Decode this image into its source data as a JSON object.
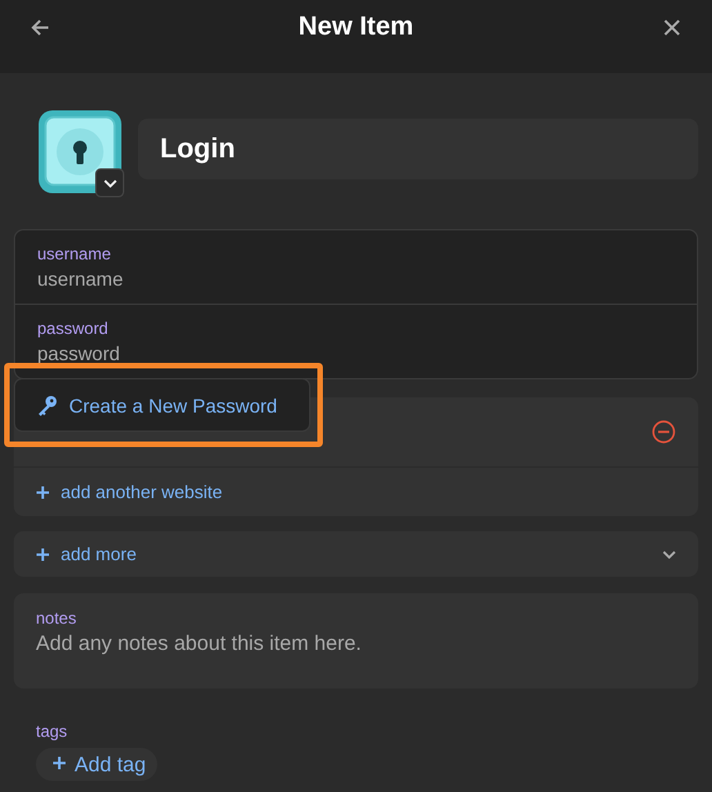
{
  "header": {
    "title": "New Item"
  },
  "item": {
    "name": "Login"
  },
  "credentials": [
    {
      "label": "username",
      "placeholder": "username"
    },
    {
      "label": "password",
      "placeholder": "password"
    }
  ],
  "website": {
    "add_label": "add another website"
  },
  "add_more": {
    "label": "add more",
    "expanded": false
  },
  "notes": {
    "label": "notes",
    "placeholder": "Add any notes about this item here."
  },
  "tags": {
    "label": "tags",
    "button": "Add tag"
  },
  "popup": {
    "label": "Create a New Password",
    "highlighted": true
  }
}
